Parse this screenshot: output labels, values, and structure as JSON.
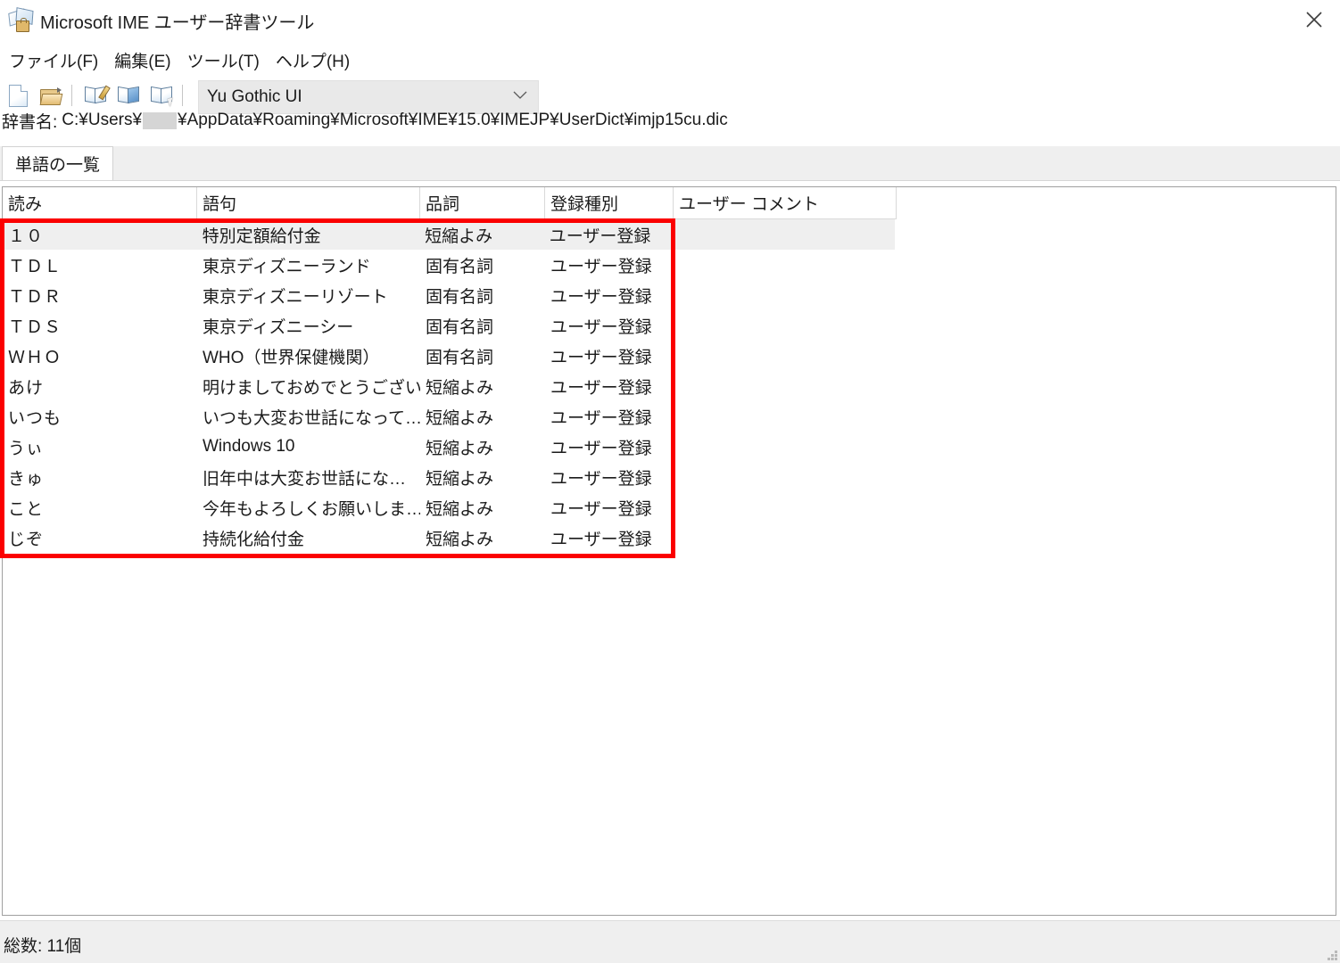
{
  "window": {
    "title": "Microsoft IME ユーザー辞書ツール",
    "icon": "dictionary-book-icon",
    "close_label": "✕"
  },
  "menu": {
    "items": [
      {
        "label": "ファイル(F)",
        "name": "file"
      },
      {
        "label": "編集(E)",
        "name": "edit"
      },
      {
        "label": "ツール(T)",
        "name": "tools"
      },
      {
        "label": "ヘルプ(H)",
        "name": "help"
      }
    ]
  },
  "toolbar": {
    "buttons": [
      {
        "icon": "new-document-icon"
      },
      {
        "icon": "open-folder-icon"
      },
      {
        "icon": "add-word-icon"
      },
      {
        "icon": "delete-word-icon"
      },
      {
        "icon": "register-word-icon"
      }
    ],
    "font_combo": {
      "value": "Yu Gothic UI",
      "chevron": "chevron-down-icon"
    }
  },
  "dictionary": {
    "label": "辞書名:",
    "path_before": "C:¥Users¥",
    "path_after": "¥AppData¥Roaming¥Microsoft¥IME¥15.0¥IMEJP¥UserDict¥imjp15cu.dic"
  },
  "tabs": [
    {
      "label": "単語の一覧",
      "active": true
    }
  ],
  "table": {
    "columns": [
      {
        "label": "読み"
      },
      {
        "label": "語句"
      },
      {
        "label": "品詞"
      },
      {
        "label": "登録種別"
      },
      {
        "label": "ユーザー コメント"
      }
    ],
    "rows": [
      {
        "reading": "１０",
        "word": "特別定額給付金",
        "pos": "短縮よみ",
        "type": "ユーザー登録",
        "comment": "",
        "selected": true
      },
      {
        "reading": "ＴＤＬ",
        "word": "東京ディズニーランド",
        "pos": "固有名詞",
        "type": "ユーザー登録",
        "comment": "",
        "selected": false
      },
      {
        "reading": "ＴＤＲ",
        "word": "東京ディズニーリゾート",
        "pos": "固有名詞",
        "type": "ユーザー登録",
        "comment": "",
        "selected": false
      },
      {
        "reading": "ＴＤＳ",
        "word": "東京ディズニーシー",
        "pos": "固有名詞",
        "type": "ユーザー登録",
        "comment": "",
        "selected": false
      },
      {
        "reading": "ＷＨＯ",
        "word": "WHO（世界保健機関）",
        "pos": "固有名詞",
        "type": "ユーザー登録",
        "comment": "",
        "selected": false
      },
      {
        "reading": "あけ",
        "word": "明けましておめでとうござい…",
        "pos": "短縮よみ",
        "type": "ユーザー登録",
        "comment": "",
        "selected": false
      },
      {
        "reading": "いつも",
        "word": "いつも大変お世話になって…",
        "pos": "短縮よみ",
        "type": "ユーザー登録",
        "comment": "",
        "selected": false
      },
      {
        "reading": "うぃ",
        "word": "Windows 10",
        "pos": "短縮よみ",
        "type": "ユーザー登録",
        "comment": "",
        "selected": false
      },
      {
        "reading": "きゅ",
        "word": "旧年中は大変お世話にな…",
        "pos": "短縮よみ",
        "type": "ユーザー登録",
        "comment": "",
        "selected": false
      },
      {
        "reading": "こと",
        "word": "今年もよろしくお願いしま…",
        "pos": "短縮よみ",
        "type": "ユーザー登録",
        "comment": "",
        "selected": false
      },
      {
        "reading": "じぞ",
        "word": "持続化給付金",
        "pos": "短縮よみ",
        "type": "ユーザー登録",
        "comment": "",
        "selected": false
      }
    ]
  },
  "annotation": {
    "shape": "rectangle",
    "color": "#fb0000"
  },
  "statusbar": {
    "total_text": "総数: 11個",
    "grip": "resize-grip-icon"
  }
}
